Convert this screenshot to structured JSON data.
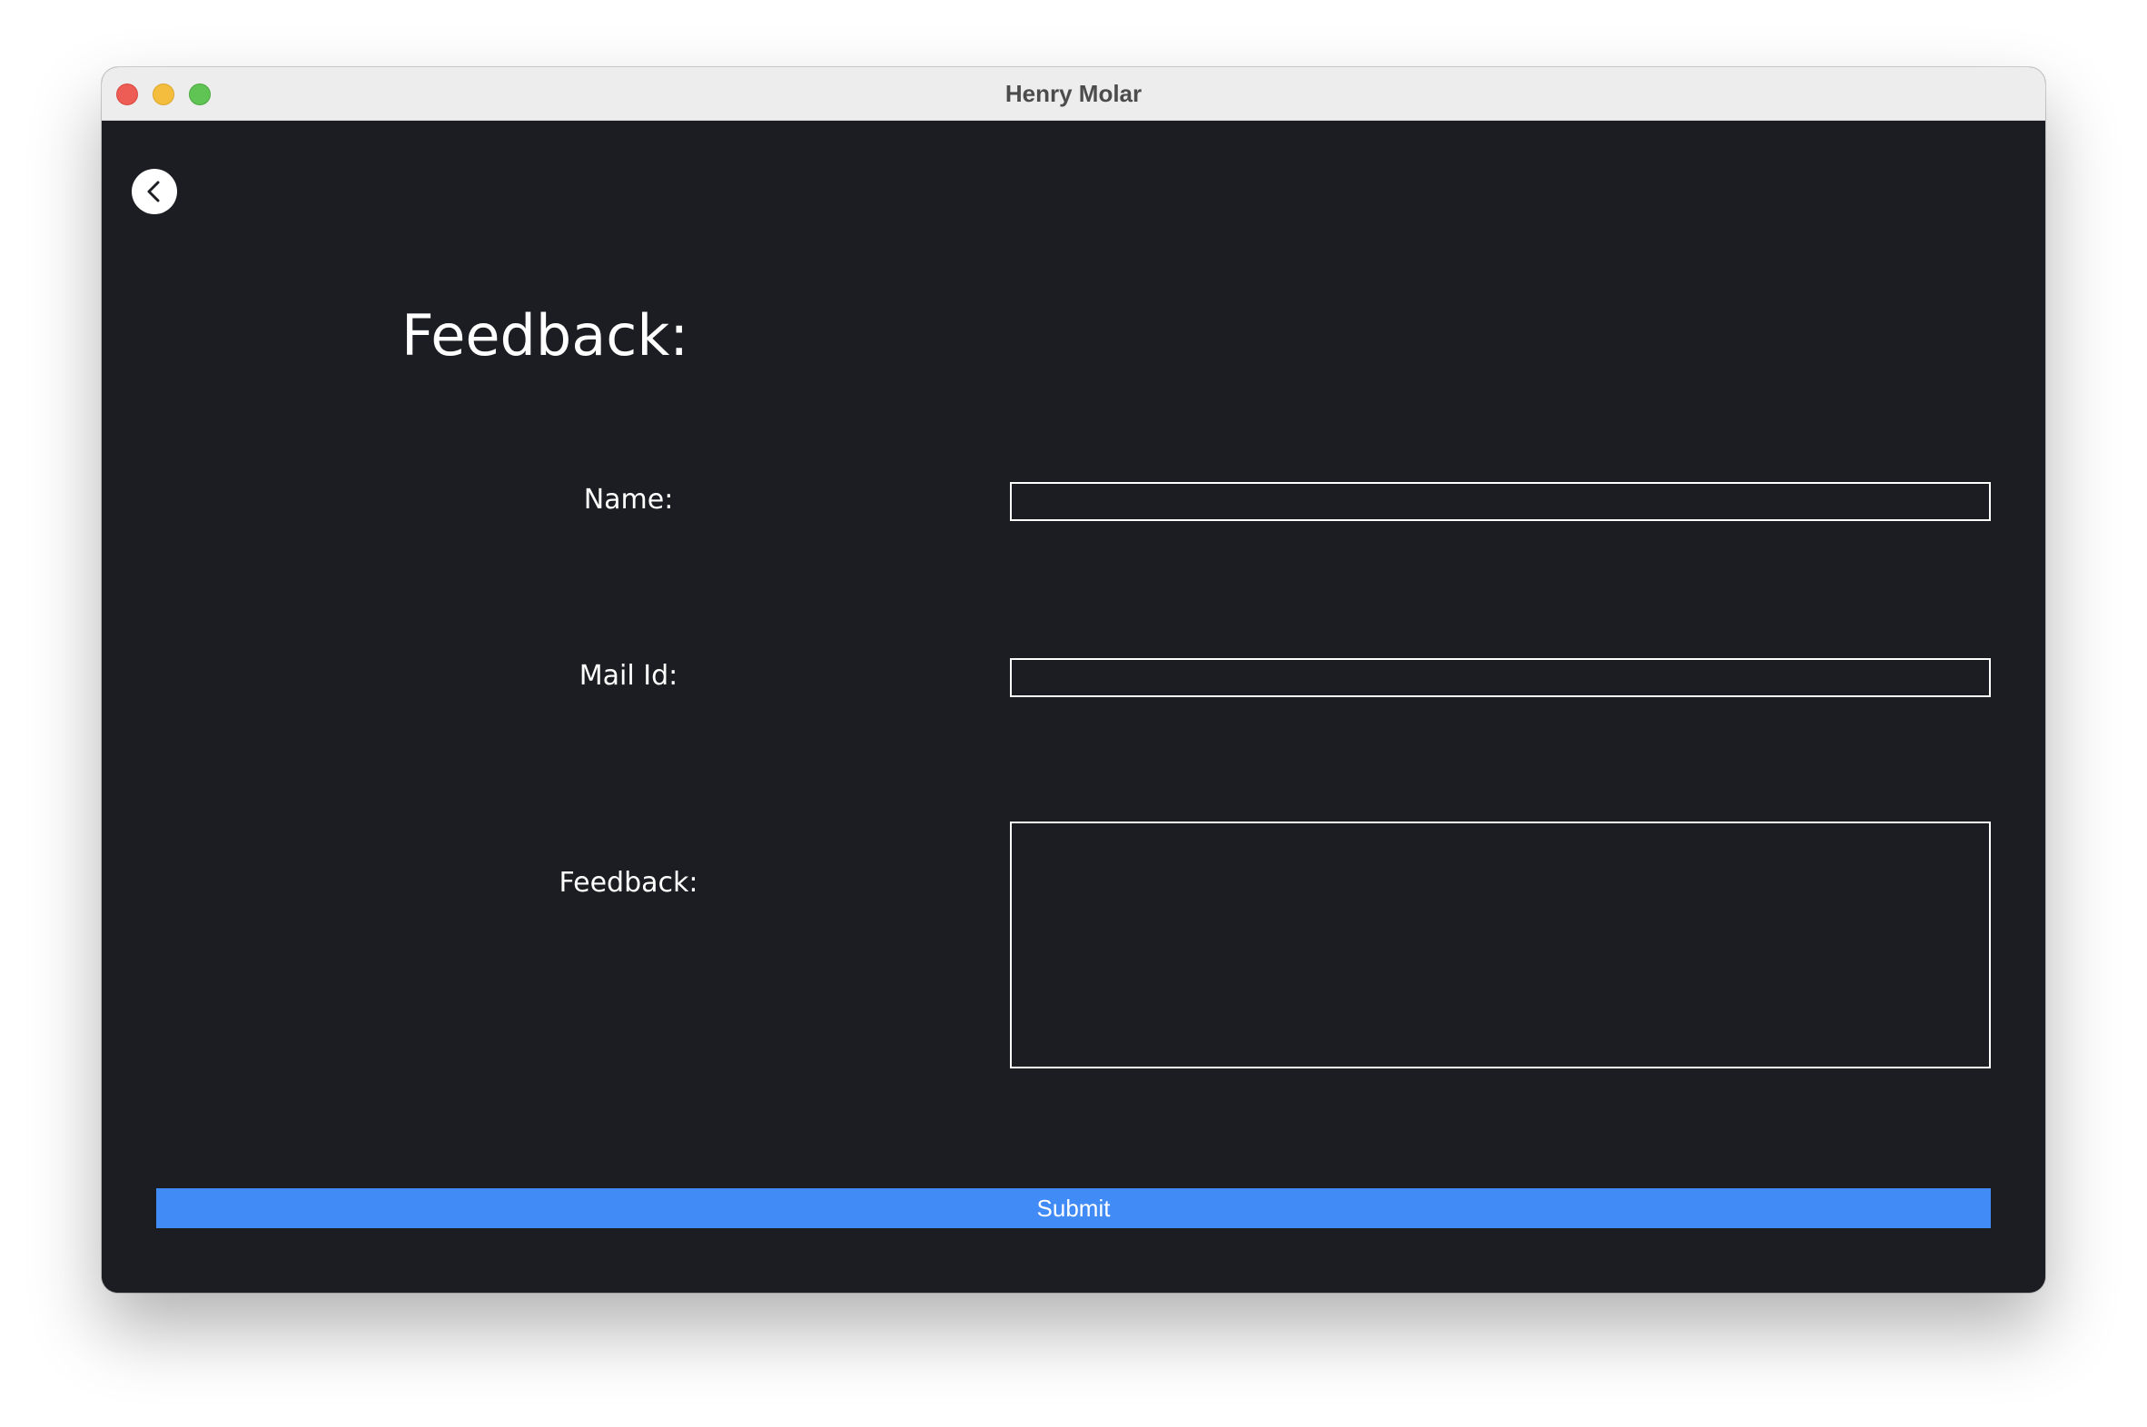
{
  "window": {
    "title": "Henry Molar"
  },
  "page": {
    "title": "Feedback:"
  },
  "form": {
    "name_label": "Name:",
    "name_value": "",
    "mail_label": "Mail Id:",
    "mail_value": "",
    "feedback_label": "Feedback:",
    "feedback_value": "",
    "submit_label": "Submit"
  },
  "icons": {
    "back": "chevron-left-icon"
  },
  "colors": {
    "background": "#1b1d22",
    "accent": "#418bf6",
    "text": "#ffffff",
    "titlebar": "#ededed"
  }
}
